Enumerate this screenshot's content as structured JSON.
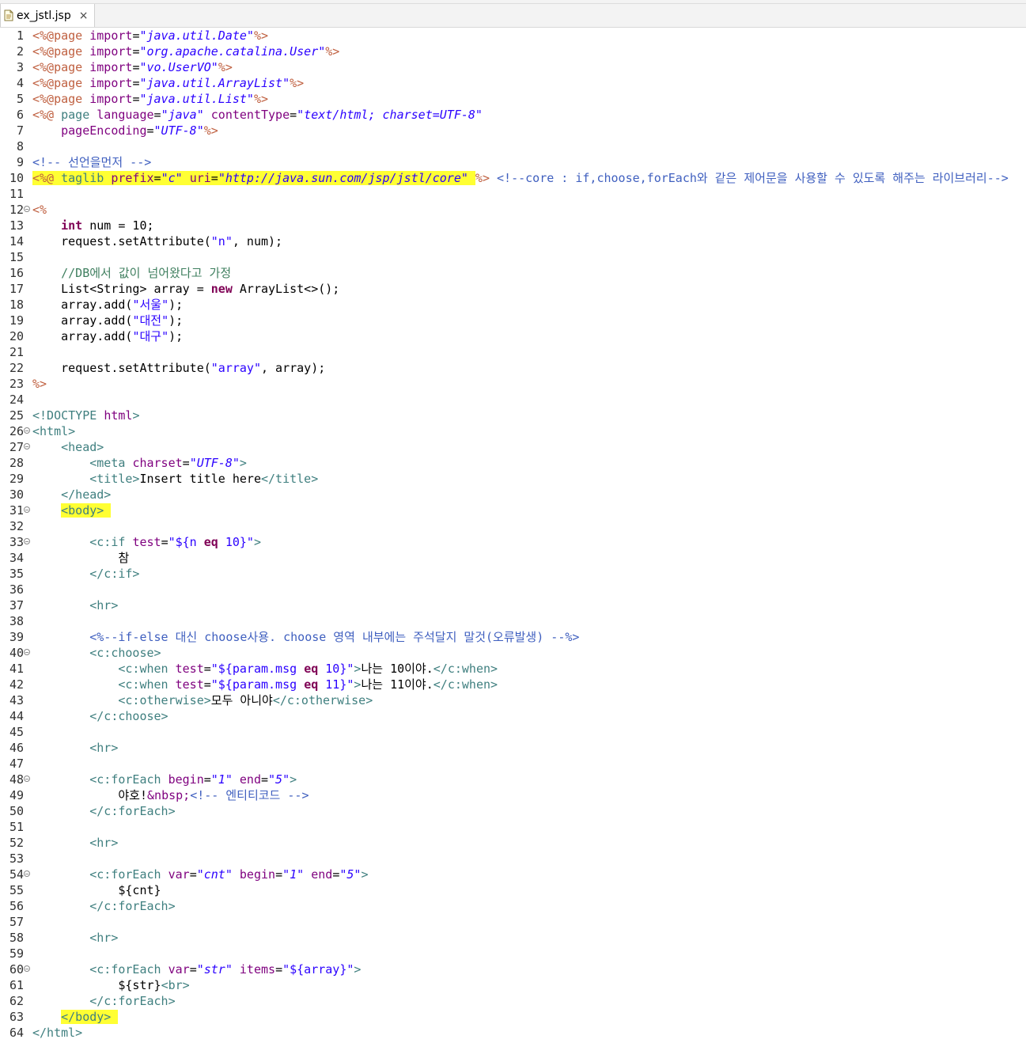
{
  "tab": {
    "file_name": "ex_jstl.jsp",
    "close": "×"
  },
  "lines": [
    {
      "n": "1",
      "segs": [
        [
          "jsp",
          "<%@page "
        ],
        [
          "attr",
          "import"
        ],
        [
          "el",
          "="
        ],
        [
          "val",
          "\"java.util.Date\""
        ],
        [
          "jsp",
          "%>"
        ]
      ]
    },
    {
      "n": "2",
      "segs": [
        [
          "jsp",
          "<%@page "
        ],
        [
          "attr",
          "import"
        ],
        [
          "el",
          "="
        ],
        [
          "val",
          "\"org.apache.catalina.User\""
        ],
        [
          "jsp",
          "%>"
        ]
      ]
    },
    {
      "n": "3",
      "segs": [
        [
          "jsp",
          "<%@page "
        ],
        [
          "attr",
          "import"
        ],
        [
          "el",
          "="
        ],
        [
          "val",
          "\"vo.UserVO\""
        ],
        [
          "jsp",
          "%>"
        ]
      ]
    },
    {
      "n": "4",
      "segs": [
        [
          "jsp",
          "<%@page "
        ],
        [
          "attr",
          "import"
        ],
        [
          "el",
          "="
        ],
        [
          "val",
          "\"java.util.ArrayList\""
        ],
        [
          "jsp",
          "%>"
        ]
      ]
    },
    {
      "n": "5",
      "segs": [
        [
          "jsp",
          "<%@page "
        ],
        [
          "attr",
          "import"
        ],
        [
          "el",
          "="
        ],
        [
          "val",
          "\"java.util.List\""
        ],
        [
          "jsp",
          "%>"
        ]
      ]
    },
    {
      "n": "6",
      "segs": [
        [
          "jsp",
          "<%@ "
        ],
        [
          "tag",
          "page "
        ],
        [
          "attr",
          "language"
        ],
        [
          "el",
          "="
        ],
        [
          "val",
          "\"java\""
        ],
        [
          "el",
          " "
        ],
        [
          "attr",
          "contentType"
        ],
        [
          "el",
          "="
        ],
        [
          "val",
          "\"text/html; charset=UTF-8\""
        ]
      ]
    },
    {
      "n": "7",
      "segs": [
        [
          "el",
          "    "
        ],
        [
          "attr",
          "pageEncoding"
        ],
        [
          "el",
          "="
        ],
        [
          "val",
          "\"UTF-8\""
        ],
        [
          "jsp",
          "%>"
        ]
      ]
    },
    {
      "n": "8",
      "segs": []
    },
    {
      "n": "9",
      "segs": [
        [
          "com",
          "<!-- 선언을먼저 -->"
        ]
      ]
    },
    {
      "n": "10",
      "hl_until": 9,
      "segs": [
        [
          "jsp",
          "<%@ "
        ],
        [
          "tag",
          "taglib "
        ],
        [
          "attr",
          "prefix"
        ],
        [
          "el",
          "="
        ],
        [
          "val",
          "\"c\""
        ],
        [
          "el",
          " "
        ],
        [
          "attr",
          "uri"
        ],
        [
          "el",
          "="
        ],
        [
          "val",
          "\"http://java.sun.com/jsp/jstl/core\""
        ],
        [
          "el",
          " "
        ],
        [
          "jsp",
          "%>"
        ],
        [
          "el",
          " "
        ],
        [
          "com",
          "<!--core : if,choose,forEach와 같은 제어문을 사용할 수 있도록 해주는 라이브러리-->"
        ]
      ]
    },
    {
      "n": "11",
      "segs": []
    },
    {
      "n": "12",
      "fold": true,
      "segs": [
        [
          "jsp",
          "<%"
        ]
      ]
    },
    {
      "n": "13",
      "segs": [
        [
          "el",
          "    "
        ],
        [
          "kw",
          "int"
        ],
        [
          "el",
          " num = 10;"
        ]
      ]
    },
    {
      "n": "14",
      "segs": [
        [
          "el",
          "    request.setAttribute("
        ],
        [
          "dq",
          "\"n\""
        ],
        [
          "el",
          ", num);"
        ]
      ]
    },
    {
      "n": "15",
      "segs": []
    },
    {
      "n": "16",
      "segs": [
        [
          "el",
          "    "
        ],
        [
          "jcom",
          "//DB에서 값이 넘어왔다고 가정"
        ]
      ]
    },
    {
      "n": "17",
      "segs": [
        [
          "el",
          "    List<String> array = "
        ],
        [
          "kw",
          "new"
        ],
        [
          "el",
          " ArrayList<>();"
        ]
      ]
    },
    {
      "n": "18",
      "segs": [
        [
          "el",
          "    array.add("
        ],
        [
          "dq",
          "\"서울\""
        ],
        [
          "el",
          ");"
        ]
      ]
    },
    {
      "n": "19",
      "segs": [
        [
          "el",
          "    array.add("
        ],
        [
          "dq",
          "\"대전\""
        ],
        [
          "el",
          ");"
        ]
      ]
    },
    {
      "n": "20",
      "segs": [
        [
          "el",
          "    array.add("
        ],
        [
          "dq",
          "\"대구\""
        ],
        [
          "el",
          ");"
        ]
      ]
    },
    {
      "n": "21",
      "segs": []
    },
    {
      "n": "22",
      "segs": [
        [
          "el",
          "    request.setAttribute("
        ],
        [
          "dq",
          "\"array\""
        ],
        [
          "el",
          ", array);"
        ]
      ]
    },
    {
      "n": "23",
      "segs": [
        [
          "jsp",
          "%>"
        ]
      ]
    },
    {
      "n": "24",
      "segs": []
    },
    {
      "n": "25",
      "segs": [
        [
          "tag",
          "<!DOCTYPE "
        ],
        [
          "attr",
          "html"
        ],
        [
          "tag",
          ">"
        ]
      ]
    },
    {
      "n": "26",
      "fold": true,
      "segs": [
        [
          "tag",
          "<html>"
        ]
      ]
    },
    {
      "n": "27",
      "fold": true,
      "segs": [
        [
          "el",
          "    "
        ],
        [
          "tag",
          "<head>"
        ]
      ]
    },
    {
      "n": "28",
      "segs": [
        [
          "el",
          "        "
        ],
        [
          "tag",
          "<meta "
        ],
        [
          "attr",
          "charset"
        ],
        [
          "el",
          "="
        ],
        [
          "val",
          "\"UTF-8\""
        ],
        [
          "tag",
          ">"
        ]
      ]
    },
    {
      "n": "29",
      "segs": [
        [
          "el",
          "        "
        ],
        [
          "tag",
          "<title>"
        ],
        [
          "el",
          "Insert title here"
        ],
        [
          "tag",
          "</title>"
        ]
      ]
    },
    {
      "n": "30",
      "segs": [
        [
          "el",
          "    "
        ],
        [
          "tag",
          "</head>"
        ]
      ]
    },
    {
      "n": "31",
      "fold": true,
      "hl_from": 1,
      "hl_until": 3,
      "segs": [
        [
          "el",
          "    "
        ],
        [
          "tag",
          "<body>"
        ],
        [
          "el",
          " "
        ]
      ]
    },
    {
      "n": "32",
      "segs": []
    },
    {
      "n": "33",
      "fold": true,
      "segs": [
        [
          "el",
          "        "
        ],
        [
          "tag",
          "<c:if "
        ],
        [
          "attr",
          "test"
        ],
        [
          "el",
          "="
        ],
        [
          "dq",
          "\"${n "
        ],
        [
          "kw",
          "eq"
        ],
        [
          "dq",
          " 10}\""
        ],
        [
          "tag",
          ">"
        ]
      ]
    },
    {
      "n": "34",
      "segs": [
        [
          "el",
          "            참"
        ]
      ]
    },
    {
      "n": "35",
      "segs": [
        [
          "el",
          "        "
        ],
        [
          "tag",
          "</c:if>"
        ]
      ]
    },
    {
      "n": "36",
      "segs": []
    },
    {
      "n": "37",
      "segs": [
        [
          "el",
          "        "
        ],
        [
          "tag",
          "<hr>"
        ]
      ]
    },
    {
      "n": "38",
      "segs": []
    },
    {
      "n": "39",
      "segs": [
        [
          "el",
          "        "
        ],
        [
          "com",
          "<%--if-else 대신 choose사용. choose 영역 내부에는 주석달지 말것(오류발생) --%>"
        ]
      ]
    },
    {
      "n": "40",
      "fold": true,
      "segs": [
        [
          "el",
          "        "
        ],
        [
          "tag",
          "<c:choose>"
        ]
      ]
    },
    {
      "n": "41",
      "segs": [
        [
          "el",
          "            "
        ],
        [
          "tag",
          "<c:when "
        ],
        [
          "attr",
          "test"
        ],
        [
          "el",
          "="
        ],
        [
          "dq",
          "\"${param.msg "
        ],
        [
          "kw",
          "eq"
        ],
        [
          "dq",
          " 10}\""
        ],
        [
          "tag",
          ">"
        ],
        [
          "el",
          "나는 10이야."
        ],
        [
          "tag",
          "</c:when>"
        ]
      ]
    },
    {
      "n": "42",
      "segs": [
        [
          "el",
          "            "
        ],
        [
          "tag",
          "<c:when "
        ],
        [
          "attr",
          "test"
        ],
        [
          "el",
          "="
        ],
        [
          "dq",
          "\"${param.msg "
        ],
        [
          "kw",
          "eq"
        ],
        [
          "dq",
          " 11}\""
        ],
        [
          "tag",
          ">"
        ],
        [
          "el",
          "나는 11이야."
        ],
        [
          "tag",
          "</c:when>"
        ]
      ]
    },
    {
      "n": "43",
      "segs": [
        [
          "el",
          "            "
        ],
        [
          "tag",
          "<c:otherwise>"
        ],
        [
          "el",
          "모두 아니야"
        ],
        [
          "tag",
          "</c:otherwise>"
        ]
      ]
    },
    {
      "n": "44",
      "segs": [
        [
          "el",
          "        "
        ],
        [
          "tag",
          "</c:choose>"
        ]
      ]
    },
    {
      "n": "45",
      "segs": []
    },
    {
      "n": "46",
      "segs": [
        [
          "el",
          "        "
        ],
        [
          "tag",
          "<hr>"
        ]
      ]
    },
    {
      "n": "47",
      "segs": []
    },
    {
      "n": "48",
      "fold": true,
      "segs": [
        [
          "el",
          "        "
        ],
        [
          "tag",
          "<c:forEach "
        ],
        [
          "attr",
          "begin"
        ],
        [
          "el",
          "="
        ],
        [
          "val",
          "\"1\""
        ],
        [
          "el",
          " "
        ],
        [
          "attr",
          "end"
        ],
        [
          "el",
          "="
        ],
        [
          "val",
          "\"5\""
        ],
        [
          "tag",
          ">"
        ]
      ]
    },
    {
      "n": "49",
      "segs": [
        [
          "el",
          "            야호!"
        ],
        [
          "attr",
          "&nbsp;"
        ],
        [
          "com",
          "<!-- 엔티티코드 -->"
        ]
      ]
    },
    {
      "n": "50",
      "segs": [
        [
          "el",
          "        "
        ],
        [
          "tag",
          "</c:forEach>"
        ]
      ]
    },
    {
      "n": "51",
      "segs": []
    },
    {
      "n": "52",
      "segs": [
        [
          "el",
          "        "
        ],
        [
          "tag",
          "<hr>"
        ]
      ]
    },
    {
      "n": "53",
      "segs": []
    },
    {
      "n": "54",
      "fold": true,
      "segs": [
        [
          "el",
          "        "
        ],
        [
          "tag",
          "<c:forEach "
        ],
        [
          "attr",
          "var"
        ],
        [
          "el",
          "="
        ],
        [
          "val",
          "\"cnt\""
        ],
        [
          "el",
          " "
        ],
        [
          "attr",
          "begin"
        ],
        [
          "el",
          "="
        ],
        [
          "val",
          "\"1\""
        ],
        [
          "el",
          " "
        ],
        [
          "attr",
          "end"
        ],
        [
          "el",
          "="
        ],
        [
          "val",
          "\"5\""
        ],
        [
          "tag",
          ">"
        ]
      ]
    },
    {
      "n": "55",
      "segs": [
        [
          "el",
          "            ${cnt}"
        ]
      ]
    },
    {
      "n": "56",
      "segs": [
        [
          "el",
          "        "
        ],
        [
          "tag",
          "</c:forEach>"
        ]
      ]
    },
    {
      "n": "57",
      "segs": []
    },
    {
      "n": "58",
      "segs": [
        [
          "el",
          "        "
        ],
        [
          "tag",
          "<hr>"
        ]
      ]
    },
    {
      "n": "59",
      "segs": []
    },
    {
      "n": "60",
      "fold": true,
      "segs": [
        [
          "el",
          "        "
        ],
        [
          "tag",
          "<c:forEach "
        ],
        [
          "attr",
          "var"
        ],
        [
          "el",
          "="
        ],
        [
          "val",
          "\"str\""
        ],
        [
          "el",
          " "
        ],
        [
          "attr",
          "items"
        ],
        [
          "el",
          "="
        ],
        [
          "dq",
          "\"${array}\""
        ],
        [
          "tag",
          ">"
        ]
      ]
    },
    {
      "n": "61",
      "segs": [
        [
          "el",
          "            ${str}"
        ],
        [
          "tag",
          "<br>"
        ]
      ]
    },
    {
      "n": "62",
      "segs": [
        [
          "el",
          "        "
        ],
        [
          "tag",
          "</c:forEach>"
        ]
      ]
    },
    {
      "n": "63",
      "hl_from": 1,
      "hl_until": 3,
      "segs": [
        [
          "el",
          "    "
        ],
        [
          "tag",
          "</body>"
        ],
        [
          "el",
          " "
        ]
      ]
    },
    {
      "n": "64",
      "segs": [
        [
          "tag",
          "</html>"
        ]
      ]
    }
  ]
}
